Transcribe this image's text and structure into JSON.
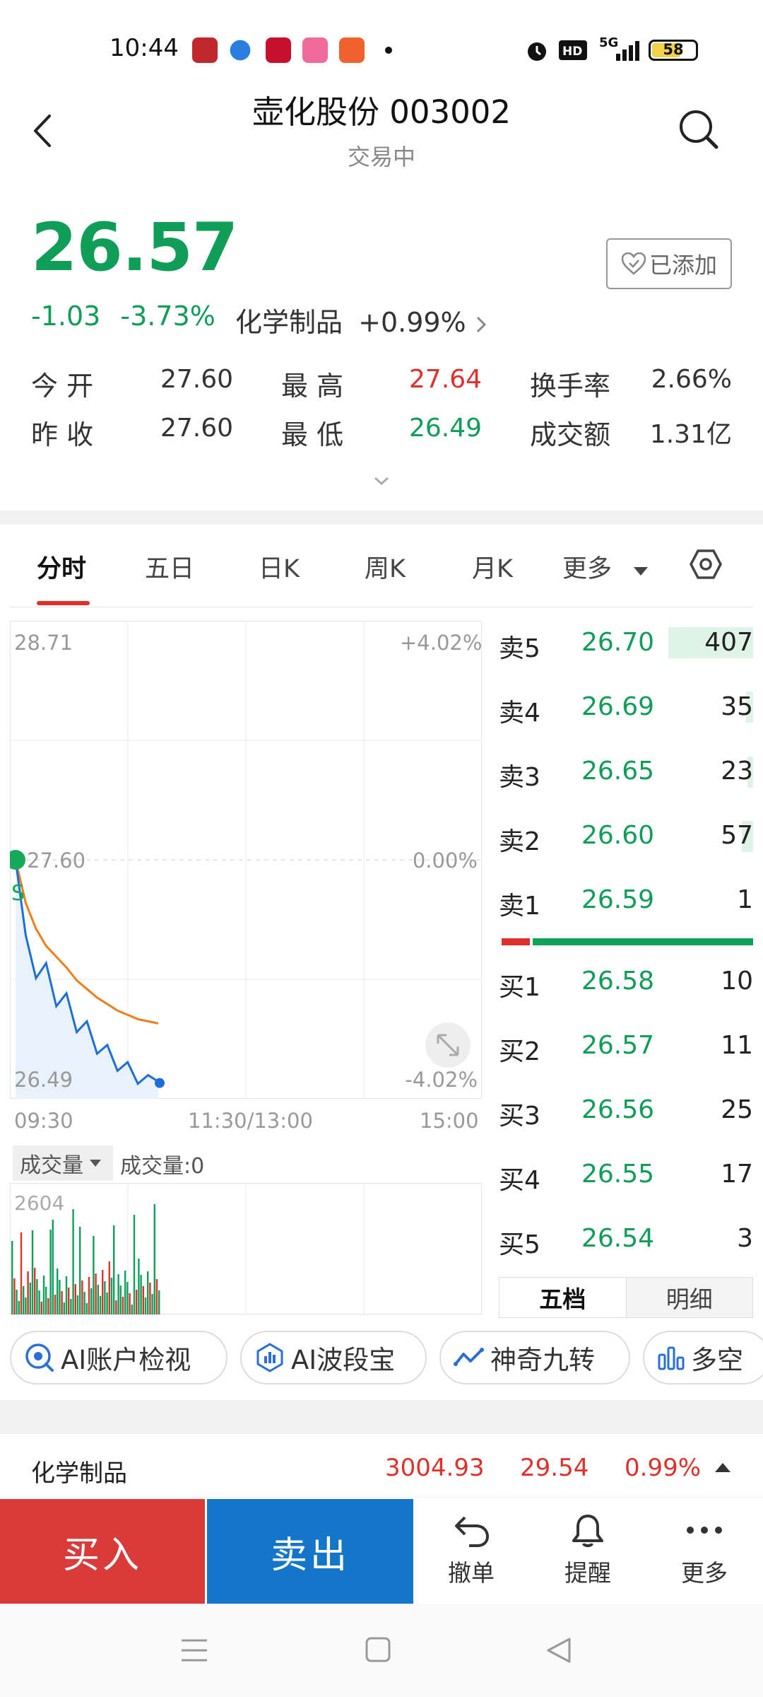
{
  "status_bar": {
    "time": "10:44",
    "network": "5G",
    "battery": "58"
  },
  "header": {
    "title": "壶化股份 003002",
    "subtitle": "交易中",
    "back_icon": "chevron-left-icon",
    "search_icon": "search-icon"
  },
  "quote": {
    "price": "26.57",
    "change": "-1.03",
    "change_pct": "-3.73%",
    "sector_name": "化学制品",
    "sector_pct": "+0.99%",
    "added_label": "已添加",
    "stats": [
      {
        "label": "今 开",
        "value": "27.60"
      },
      {
        "label": "最 高",
        "value": "27.64"
      },
      {
        "label": "换手率",
        "value": "2.66%"
      },
      {
        "label": "昨 收",
        "value": "27.60"
      },
      {
        "label": "最 低",
        "value": "26.49"
      },
      {
        "label": "成交额",
        "value": "1.31亿"
      }
    ]
  },
  "tabs": [
    "分时",
    "五日",
    "日K",
    "周K",
    "月K",
    "更多"
  ],
  "chart": {
    "y_top": "28.71",
    "y_mid": "27.60",
    "y_bot": "26.49",
    "pct_top": "+4.02%",
    "pct_mid": "0.00%",
    "pct_bot": "-4.02%",
    "x_start": "09:30",
    "x_mid": "11:30/13:00",
    "x_end": "15:00",
    "marker": "S",
    "volume_tag": "成交量",
    "volume_text": "成交量:0",
    "volume_max": "2604"
  },
  "chart_data": {
    "type": "line",
    "title": "",
    "ylim": [
      26.49,
      28.71
    ],
    "series": [
      {
        "values": [
          27.6,
          27.25,
          27.05,
          27.12,
          26.92,
          26.98,
          26.8,
          26.85,
          26.7,
          26.74,
          26.62,
          26.66,
          26.56,
          26.6,
          26.57
        ]
      },
      {
        "values": [
          27.6,
          27.4,
          27.28,
          27.2,
          27.15,
          27.1,
          27.04,
          27.0,
          26.96,
          26.93,
          26.9,
          26.88,
          26.86,
          26.85,
          26.84
        ]
      }
    ]
  },
  "order_book": {
    "asks": [
      {
        "label": "卖5",
        "price": "26.70",
        "vol": "407"
      },
      {
        "label": "卖4",
        "price": "26.69",
        "vol": "35"
      },
      {
        "label": "卖3",
        "price": "26.65",
        "vol": "23"
      },
      {
        "label": "卖2",
        "price": "26.60",
        "vol": "57"
      },
      {
        "label": "卖1",
        "price": "26.59",
        "vol": "1"
      }
    ],
    "bids": [
      {
        "label": "买1",
        "price": "26.58",
        "vol": "10"
      },
      {
        "label": "买2",
        "price": "26.57",
        "vol": "11"
      },
      {
        "label": "买3",
        "price": "26.56",
        "vol": "25"
      },
      {
        "label": "买4",
        "price": "26.55",
        "vol": "17"
      },
      {
        "label": "买5",
        "price": "26.54",
        "vol": "3"
      }
    ],
    "tab_five": "五档",
    "tab_detail": "明细"
  },
  "tools": [
    "AI账户检视",
    "AI波段宝",
    "神奇九转",
    "多空"
  ],
  "sector_row": {
    "name": "化学制品",
    "index": "3004.93",
    "change": "29.54",
    "pct": "0.99%"
  },
  "bottom": {
    "buy": "买入",
    "sell": "卖出",
    "cancel": "撤单",
    "alert": "提醒",
    "more": "更多"
  },
  "colors": {
    "up": "#e0302b",
    "down": "#0f9d58",
    "buy_bg": "#d93a3a",
    "sell_bg": "#1476c9"
  }
}
